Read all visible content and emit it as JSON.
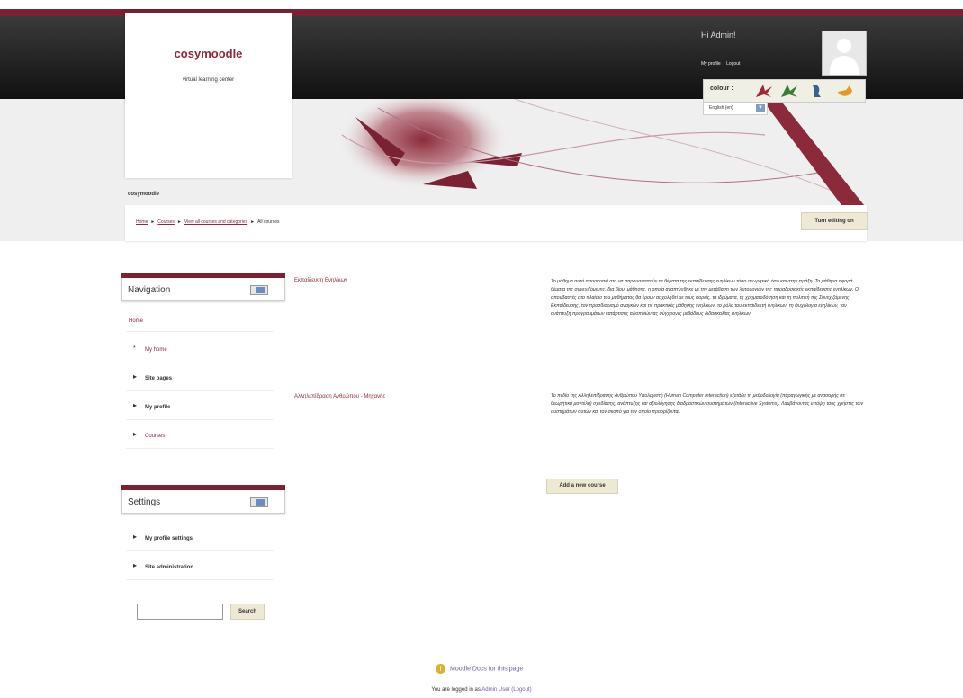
{
  "header": {
    "logo_title": "cosymoodle",
    "logo_subtitle": "virtual learning center",
    "site_name": "cosymoodle",
    "greeting": "Hi Admin!",
    "my_profile": "My profile",
    "logout": "Logout",
    "colour_label": "colour :",
    "language": "English (en)"
  },
  "breadcrumb": {
    "home": "Home",
    "courses": "Courses",
    "view_all": "View all courses and categories",
    "current": "All courses",
    "separator": "►"
  },
  "turn_editing": "Turn editing on",
  "navigation": {
    "title": "Navigation",
    "home": "Home",
    "items": [
      {
        "label": "My home"
      },
      {
        "label": "Site pages"
      },
      {
        "label": "My profile"
      },
      {
        "label": "Courses"
      }
    ]
  },
  "settings": {
    "title": "Settings",
    "items": [
      {
        "label": "My profile settings"
      },
      {
        "label": "Site administration"
      }
    ]
  },
  "courses": [
    {
      "name": "Εκπαίδευση Ενηλίκων",
      "summary": "Το μάθημα αυτό αποσκοπεί στο να παρουσιαστούν τα θέματα της εκπαίδευσης ενηλίκων τόσο σεωρητικά όσο και στην πράξη. Το μάθημα αφορά θέματα της συνεχιζόμενης, δια βίου, μάθησης, η οποία αναπτύχθηκε με την μετάβαση των λειτουργιών της παραδοσιακής εκπαίδευσης ενηλίκων. Οι σπουδαστές στο πλαίσιο του μαθήματος θα έρουν ασχοληθεί με τους φορείς, τα ιδρύματα, τη χρηματοδότηση και τη πολιτική της Συνεχιζόμενης Εκπαίδευσης, τον προσδιορισμό αναγκών και τις πρακτικές μάθησης ενηλίκων, το ρόλο του εκπαιδευτή ενηλίκων, τη ψυχολογία ενηλίκων, τον ανάπτυξη προγραμμάτων κατάρτισης αξιοποιώντας σύγχρονες μεθόδους διδασκαλίας ενηλίκων."
    },
    {
      "name": "Αλληλεπίδραση Ανθρώπου - Μηχανής",
      "summary": "Το πεδίο της Αλληλεπίδρασης Ανθρώπου Υπολογιστή (Human Computer Interaction) εξετάζει τη μεθοδολογία (παραγωγικής με ανασορής σε θεωρητικά μοντέλα) σχεδίασης, ανάπτυξης και αξιολόγησης διαδραστικών συστημάτων (Interactive Systems). Λαμβάνοντας υπόψη τους χρήστες των συστημάτων αυτών και τον σκοπό για τον οποίο προορίζονται."
    }
  ],
  "add_course": "Add a new course",
  "search": {
    "button": "Search",
    "value": ""
  },
  "footer": {
    "docs_link": "Moodle Docs for this page",
    "logged_in_prefix": "You are logged in as",
    "user": "Admin User",
    "logout": "(Logout)"
  },
  "colors": {
    "accent": "#7a2233",
    "link": "#8a2a3a",
    "footer_link": "#6e5ea8"
  }
}
